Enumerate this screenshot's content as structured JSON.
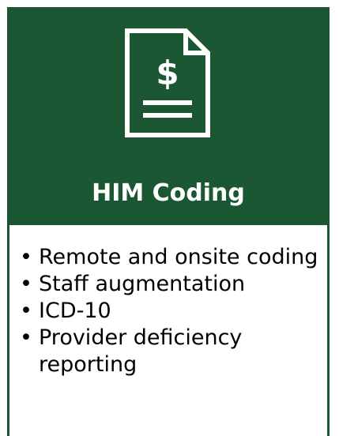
{
  "card": {
    "title": "HIM Coding",
    "icon": "invoice-document-dollar-icon",
    "accent_color": "#1c5733",
    "services": [
      "Remote and onsite coding",
      "Staff augmentation",
      "ICD-10",
      "Provider deficiency reporting"
    ],
    "bullet": "•"
  }
}
